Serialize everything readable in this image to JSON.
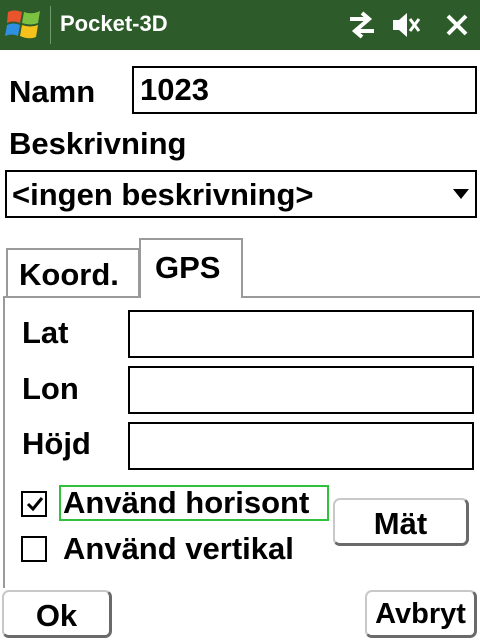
{
  "titlebar": {
    "title": "Pocket-3D",
    "icons": [
      "windows-start-icon",
      "connectivity-icon",
      "volume-muted-icon",
      "close-icon"
    ]
  },
  "form": {
    "name_label": "Namn",
    "name_value": "1023",
    "description_label": "Beskrivning",
    "description_value": "<ingen beskrivning>"
  },
  "tabs": [
    {
      "label": "Koord."
    },
    {
      "label": "GPS"
    }
  ],
  "gps": {
    "lat_label": "Lat",
    "lat_value": "",
    "lon_label": "Lon",
    "lon_value": "",
    "height_label": "Höjd",
    "height_value": "",
    "use_horizontal_label": "Använd horisont",
    "use_horizontal_checked": true,
    "use_vertical_label": "Använd vertikal",
    "use_vertical_checked": false,
    "measure_button": "Mät"
  },
  "buttons": {
    "ok": "Ok",
    "cancel": "Avbryt"
  },
  "colors": {
    "titlebar_bg": "#2d5c2a",
    "focus_outline": "#2fc23a"
  }
}
